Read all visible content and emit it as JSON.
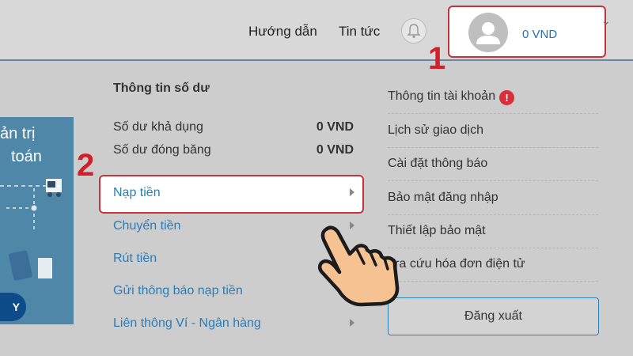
{
  "header": {
    "nav": [
      "Hướng dẫn",
      "Tin tức"
    ],
    "balance": "0 VND"
  },
  "steps": [
    "1",
    "2"
  ],
  "banner": {
    "line1": "ản trị",
    "line2": "toán",
    "button": "Y"
  },
  "balance_panel": {
    "title": "Thông tin số dư",
    "rows": [
      {
        "label": "Số dư khả dụng",
        "value": "0 VND"
      },
      {
        "label": "Số dư đóng băng",
        "value": "0 VND"
      }
    ]
  },
  "left_menu": [
    "Nạp tiền",
    "Chuyển tiền",
    "Rút tiền",
    "Gửi thông báo nạp tiền",
    "Liên thông Ví - Ngân hàng"
  ],
  "right_menu": [
    "Thông tin tài khoản",
    "Lịch sử giao dịch",
    "Cài đặt thông báo",
    "Bảo mật đăng nhập",
    "Thiết lập bảo mật",
    "Tra cứu hóa đơn điện tử"
  ],
  "warning_icon_text": "!",
  "logout": "Đăng xuất",
  "colors": {
    "accent": "#2a7db8",
    "highlight": "#c8323c",
    "banner": "#4f87a8"
  }
}
